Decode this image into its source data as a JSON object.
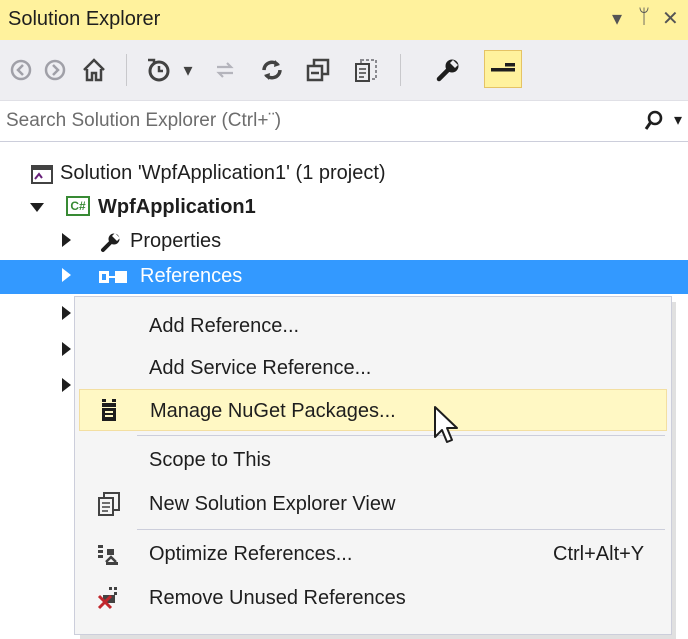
{
  "window": {
    "title": "Solution Explorer",
    "controls": {
      "dropdown": "▾",
      "pin": "ᛘ",
      "close": "✕"
    }
  },
  "toolbar": {
    "items": [
      "back-icon",
      "forward-icon",
      "home-icon",
      "history-icon",
      "sync-icon",
      "refresh-icon",
      "collapse-all-icon",
      "show-all-files-icon",
      "properties-icon",
      "preview-icon"
    ],
    "dropdown_glyph": "▾"
  },
  "search": {
    "placeholder": "Search Solution Explorer (Ctrl+¨)",
    "icon_glyph": "⚲"
  },
  "tree": {
    "solution": "Solution 'WpfApplication1' (1 project)",
    "project": "WpfApplication1",
    "project_badge": "C#",
    "properties": "Properties",
    "references": "References"
  },
  "context_menu": {
    "items": [
      {
        "label": "Add Reference...",
        "shortcut": ""
      },
      {
        "label": "Add Service Reference...",
        "shortcut": ""
      },
      {
        "label": "Manage NuGet Packages...",
        "shortcut": ""
      },
      {
        "label": "Scope to This",
        "shortcut": ""
      },
      {
        "label": "New Solution Explorer View",
        "shortcut": ""
      },
      {
        "label": "Optimize References...",
        "shortcut": "Ctrl+Alt+Y"
      },
      {
        "label": "Remove Unused References",
        "shortcut": ""
      }
    ]
  },
  "colors": {
    "title_bar": "#fff29d",
    "selection": "#3399ff",
    "menu_background": "#f5f5f5",
    "menu_hover": "#fff8c4"
  }
}
